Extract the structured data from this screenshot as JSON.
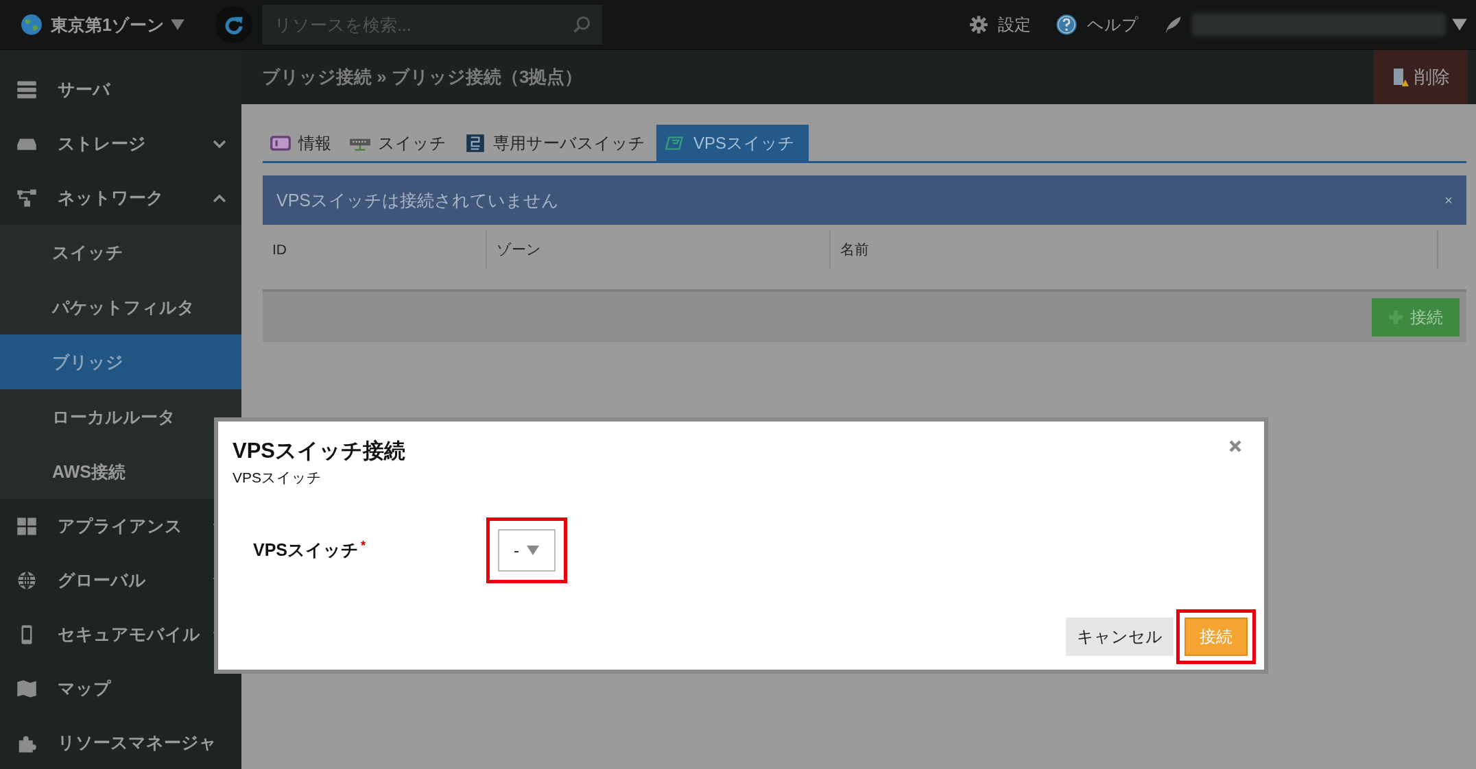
{
  "topbar": {
    "zone": "東京第1ゾーン",
    "search": {
      "placeholder": "リソースを検索..."
    },
    "links": [
      "設定",
      "ヘルプ"
    ]
  },
  "sidebar": {
    "items": [
      {
        "label": "サーバ",
        "kind": "link"
      },
      {
        "label": "ストレージ",
        "kind": "group",
        "expanded": false
      },
      {
        "label": "ネットワーク",
        "kind": "group",
        "expanded": true,
        "children": [
          {
            "label": "スイッチ",
            "selected": false
          },
          {
            "label": "パケットフィルタ",
            "selected": false
          },
          {
            "label": "ブリッジ",
            "selected": true
          },
          {
            "label": "ローカルルータ",
            "selected": false
          },
          {
            "label": "AWS接続",
            "selected": false
          }
        ]
      },
      {
        "label": "アプライアンス",
        "kind": "group",
        "expanded": false
      },
      {
        "label": "グローバル",
        "kind": "group",
        "expanded": false
      },
      {
        "label": "セキュアモバイル",
        "kind": "group",
        "expanded": false
      },
      {
        "label": "マップ",
        "kind": "link"
      },
      {
        "label": "リソースマネージャ",
        "kind": "link"
      }
    ]
  },
  "page": {
    "title": "ブリッジ接続 » ブリッジ接続（3拠点）",
    "delete_button": "削除"
  },
  "tabs": [
    {
      "label": "情報",
      "selected": false
    },
    {
      "label": "スイッチ",
      "selected": false
    },
    {
      "label": "専用サーバスイッチ",
      "selected": false
    },
    {
      "label": "VPSスイッチ",
      "selected": true
    }
  ],
  "alert": {
    "text": "VPSスイッチは接続されていません",
    "close": "×"
  },
  "table": {
    "columns": [
      "ID",
      "ゾーン",
      "名前"
    ]
  },
  "add_button": "接続",
  "dialog": {
    "title": "VPSスイッチ接続",
    "subtitle": "VPSスイッチ",
    "field": {
      "label": "VPSスイッチ",
      "required_mark": "*",
      "value": "-",
      "highlighted": true
    },
    "buttons": [
      {
        "label": "キャンセル",
        "kind": "secondary",
        "highlighted": false
      },
      {
        "label": "接続",
        "kind": "primary",
        "highlighted": true
      }
    ]
  }
}
